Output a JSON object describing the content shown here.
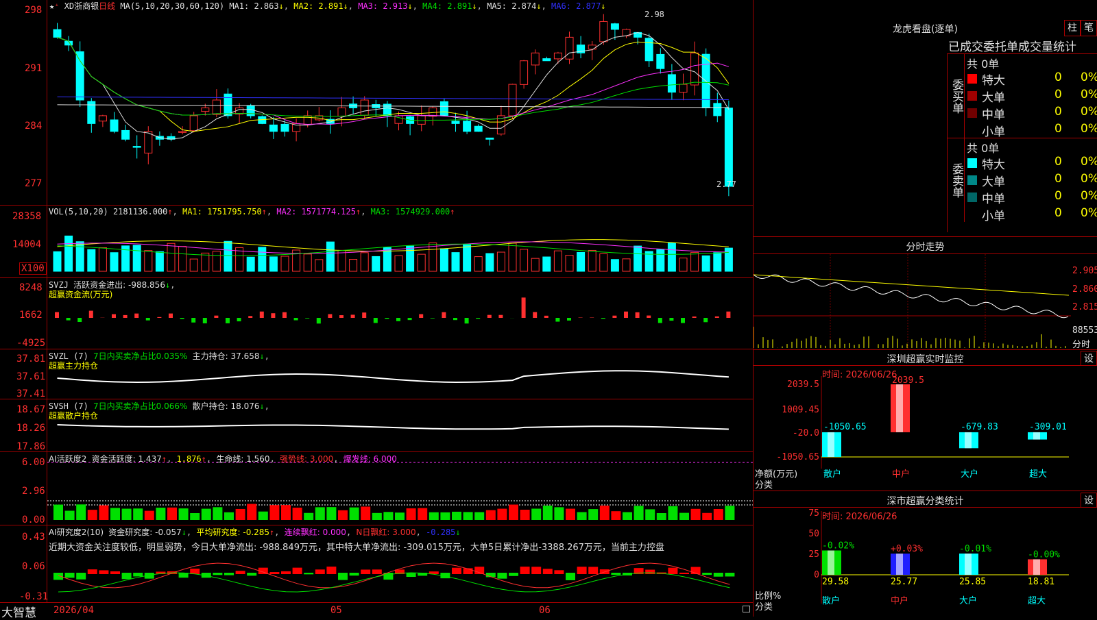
{
  "main": {
    "title": "XD浙商银",
    "period": "日线",
    "ma_params": "MA(5,10,20,30,60,120)",
    "ma": [
      {
        "label": "MA1: 2.863",
        "color": "#e0e0e0"
      },
      {
        "label": "MA2: 2.891",
        "color": "#ffff00"
      },
      {
        "label": "MA3: 2.913",
        "color": "#ff30ff"
      },
      {
        "label": "MA4: 2.891",
        "color": "#00e000"
      },
      {
        "label": "MA5: 2.874",
        "color": "#e0e0e0"
      },
      {
        "label": "MA6: 2.877",
        "color": "#3030ff"
      }
    ],
    "y_ticks": [
      "298",
      "291",
      "284",
      "277"
    ],
    "high_mark": "2.98",
    "low_mark": "2.77"
  },
  "vol": {
    "label": "VOL(5,10,20)",
    "value": "2181136.000",
    "ma1": "MA1: 1751795.750",
    "ma2": "MA2: 1571774.125",
    "ma3": "MA3: 1574929.000",
    "y_ticks": [
      "28358",
      "14004"
    ],
    "unit": "X100"
  },
  "svzj": {
    "label": "SVZJ",
    "title": "活跃资金进出: -988.856",
    "subtitle": "超赢资金流(万元)",
    "y_ticks": [
      "8248",
      "1662",
      "-4925"
    ]
  },
  "svzl": {
    "label": "SVZL (7)",
    "ratio": "7日内买卖净占比0.035%",
    "hold": "主力持仓: 37.658",
    "subtitle": "超赢主力持仓",
    "y_ticks": [
      "37.81",
      "37.61",
      "37.41"
    ]
  },
  "svsh": {
    "label": "SVSH (7)",
    "ratio": "7日内买卖净占比0.066%",
    "hold": "散户持仓: 18.076",
    "subtitle": "超赢散户持仓",
    "y_ticks": [
      "18.67",
      "18.26",
      "17.86"
    ]
  },
  "ai1": {
    "label": "AI活跃度2",
    "act": "资金活跃度: 1.437",
    "v2": "1.876",
    "life": "生命线: 1.560",
    "strong": "强势线: 3.000",
    "burst": "爆发线: 6.000",
    "y_ticks": [
      "6.00",
      "2.96",
      "0.00"
    ]
  },
  "ai2": {
    "label": "AI研究度2(10)",
    "res": "资金研究度: -0.057",
    "avg": "平均研究度: -0.285",
    "red": "连续飘红: 0.000",
    "nred": "N日飘红: 3.000",
    "last": "-0.285",
    "comment": "近期大资金关注度较低，明显弱势，今日大单净流出: -988.849万元，其中特大单净流出: -309.015万元，大单5日累计净出-3388.267万元，当前主力控盘",
    "y_ticks": [
      "0.43",
      "0.06",
      "-0.31"
    ]
  },
  "bottom": {
    "brand": "大智慧",
    "date": "2026/04",
    "m1": "05",
    "m2": "06"
  },
  "right": {
    "lhb_title": "龙虎看盘(逐单)",
    "btn_zhu": "柱",
    "btn_bi": "笔",
    "tabs": "已成交委托单成交量统计",
    "buy": {
      "side": "委买单",
      "total": "共 0单",
      "rows": [
        {
          "name": "特大",
          "v": "0",
          "p": "0%",
          "color": "#ff0000"
        },
        {
          "name": "大单",
          "v": "0",
          "p": "0%",
          "color": "#a00000"
        },
        {
          "name": "中单",
          "v": "0",
          "p": "0%",
          "color": "#700000"
        },
        {
          "name": "小单",
          "v": "0",
          "p": "0%",
          "color": "#000000"
        }
      ]
    },
    "sell": {
      "side": "委卖单",
      "total": "共 0单",
      "rows": [
        {
          "name": "特大",
          "v": "0",
          "p": "0%",
          "color": "#00ffff"
        },
        {
          "name": "大单",
          "v": "0",
          "p": "0%",
          "color": "#008888"
        },
        {
          "name": "中单",
          "v": "0",
          "p": "0%",
          "color": "#006666"
        },
        {
          "name": "小单",
          "v": "0",
          "p": "0%",
          "color": "#000000"
        }
      ]
    },
    "fs_title": "分时走势",
    "fs_ticks": [
      "2.905",
      "2.860",
      "2.815"
    ],
    "fs_vol": "88553",
    "fs_unit": "分时",
    "sz_title": "深圳超赢实时监控",
    "sz_btn": "设",
    "sz_time": "时间: 2026/06/26",
    "sz_ticks": [
      "2039.5",
      "1009.45",
      "-20.0",
      "-1050.65"
    ],
    "sz_vals": [
      {
        "cat": "散户",
        "v": "-1050.65"
      },
      {
        "cat": "中户",
        "v": "2039.5"
      },
      {
        "cat": "大户",
        "v": "-679.83"
      },
      {
        "cat": "超大",
        "v": "-309.01"
      }
    ],
    "sz_ylabel": "净额(万元)",
    "sz_xlabel": "分类",
    "ss_title": "深市超赢分类统计",
    "ss_btn": "设",
    "ss_time": "时间: 2026/06/26",
    "ss_ticks": [
      "75",
      "50",
      "25",
      "0"
    ],
    "ss_vals": [
      {
        "cat": "散户",
        "v": "29.58",
        "d": "-0.02%"
      },
      {
        "cat": "中户",
        "v": "25.77",
        "d": "+0.03%"
      },
      {
        "cat": "大户",
        "v": "25.85",
        "d": "-0.01%"
      },
      {
        "cat": "超大",
        "v": "18.81",
        "d": "-0.00%"
      }
    ],
    "ss_ylabel": "比例%",
    "ss_xlabel": "分类"
  }
}
